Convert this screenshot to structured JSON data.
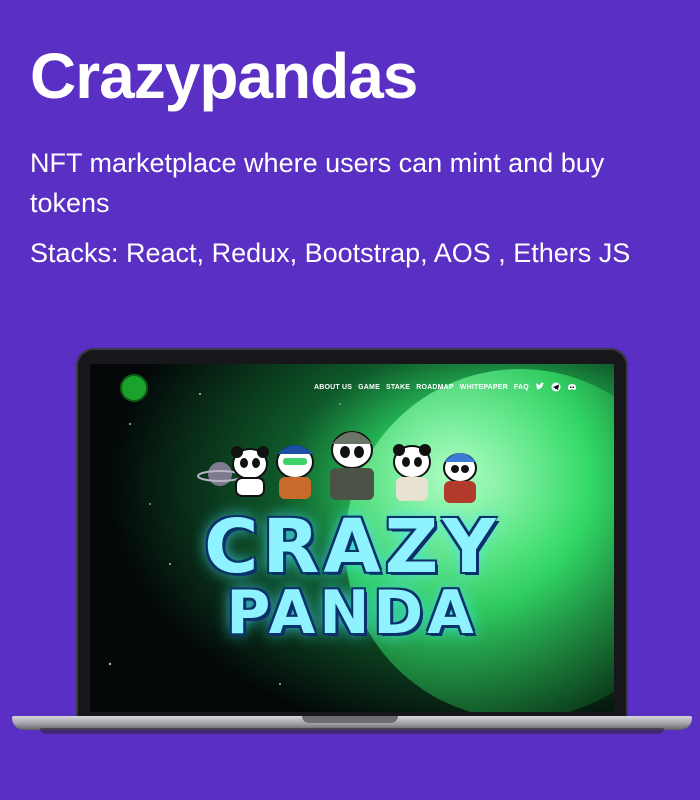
{
  "heading": {
    "title": "Crazypandas",
    "description": "NFT marketplace where users can mint and buy tokens",
    "stacks": "Stacks: React, Redux, Bootstrap, AOS , Ethers JS"
  },
  "site": {
    "nav": [
      "ABOUT US",
      "GAME",
      "STAKE",
      "ROADMAP",
      "WHITEPAPER",
      "FAQ"
    ],
    "icons": [
      "twitter-icon",
      "telegram-icon",
      "discord-icon"
    ],
    "hero_line1": "CRAZY",
    "hero_line2": "PANDA"
  },
  "colors": {
    "background": "#5a2fc4",
    "text": "#ffffff",
    "hero_text": "#8ff3ff",
    "planet_green": "#2fe36a"
  }
}
